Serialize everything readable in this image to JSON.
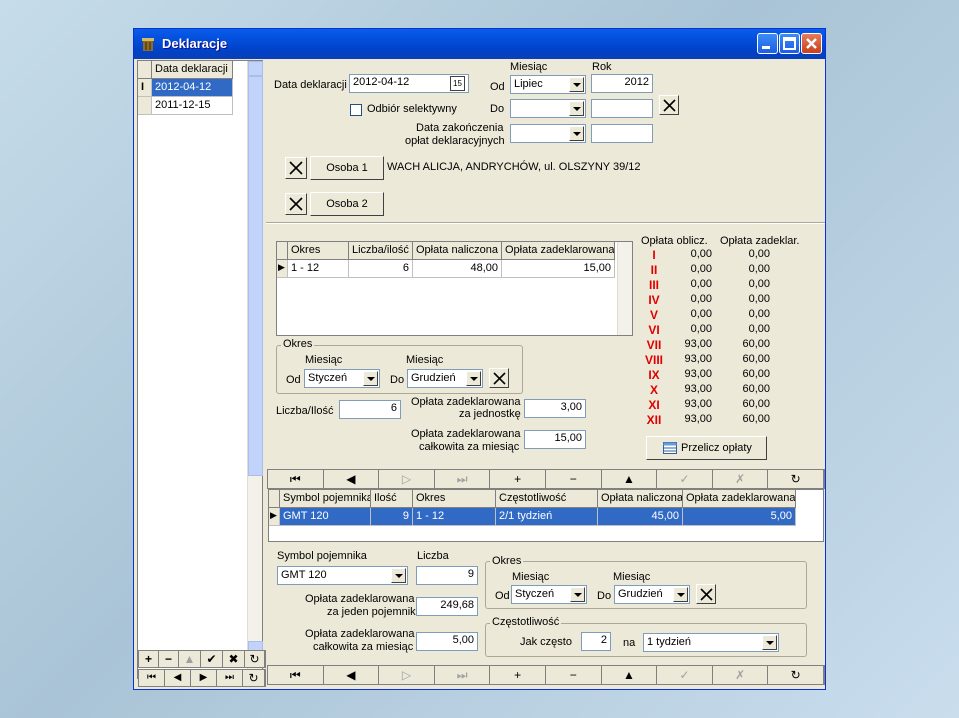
{
  "window": {
    "title": "Deklaracje"
  },
  "left_list": {
    "header": "Data deklaracji",
    "rows": [
      "2012-04-12",
      "2011-12-15"
    ]
  },
  "left_nav": {
    "row1": [
      "+",
      "−",
      "▲",
      "✔",
      "✖",
      "↻"
    ],
    "row2": [
      "⏮",
      "◀",
      "▶",
      "⏭",
      "↻"
    ]
  },
  "form": {
    "data_deklaracji_label": "Data deklaracji",
    "data_deklaracji_value": "2012-04-12",
    "calendar_icon_text": "15",
    "odbior_label": "Odbiór selektywny",
    "miesiac_header": "Miesiąc",
    "rok_header": "Rok",
    "od_label": "Od",
    "od_miesiac": "Lipiec",
    "od_rok": "2012",
    "do_label": "Do",
    "do_miesiac": "",
    "do_rok": "",
    "zakonczenie_line1": "Data zakończenia",
    "zakonczenie_line2": "opłat deklaracyjnych",
    "osoba1_label": "Osoba 1",
    "osoba1_text": "WACH ALICJA, ANDRYCHÓW, ul. OLSZYNY 39/12",
    "osoba2_label": "Osoba 2"
  },
  "period_grid": {
    "headers": [
      "Okres",
      "Liczba/ilość",
      "Opłata naliczona",
      "Opłata zadeklarowana"
    ],
    "rows": [
      [
        "1 - 12",
        "6",
        "48,00",
        "15,00"
      ]
    ]
  },
  "okres_group": {
    "title": "Okres",
    "miesiac1": "Miesiąc",
    "miesiac2": "Miesiąc",
    "od_label": "Od",
    "od_value": "Styczeń",
    "do_label": "Do",
    "do_value": "Grudzień"
  },
  "liczba": {
    "label": "Liczba/Ilość",
    "value": "6"
  },
  "oplata_jedn": {
    "line1": "Opłata zadeklarowana",
    "line2": "za jednostkę",
    "value": "3,00"
  },
  "oplata_calk": {
    "line1": "Opłata zadeklarowana",
    "line2": "całkowita za miesiąc",
    "value": "15,00"
  },
  "months_table": {
    "header_oblicz": "Opłata oblicz.",
    "header_zadekl": "Opłata zadeklar.",
    "rows": [
      [
        "I",
        "0,00",
        "0,00"
      ],
      [
        "II",
        "0,00",
        "0,00"
      ],
      [
        "III",
        "0,00",
        "0,00"
      ],
      [
        "IV",
        "0,00",
        "0,00"
      ],
      [
        "V",
        "0,00",
        "0,00"
      ],
      [
        "VI",
        "0,00",
        "0,00"
      ],
      [
        "VII",
        "93,00",
        "60,00"
      ],
      [
        "VIII",
        "93,00",
        "60,00"
      ],
      [
        "IX",
        "93,00",
        "60,00"
      ],
      [
        "X",
        "93,00",
        "60,00"
      ],
      [
        "XI",
        "93,00",
        "60,00"
      ],
      [
        "XII",
        "93,00",
        "60,00"
      ]
    ]
  },
  "przelicz_label": "Przelicz opłaty",
  "nav1": [
    "⏮",
    "◀",
    "▷",
    "⏭",
    "+",
    "−",
    "▲",
    "✓",
    "✗",
    "↻"
  ],
  "container_grid": {
    "headers": [
      "Symbol pojemnika",
      "Ilość",
      "Okres",
      "Częstotliwość",
      "Opłata naliczona",
      "Opłata zadeklarowana"
    ],
    "rows": [
      [
        "GMT 120",
        "9",
        "1 - 12",
        "2/1 tydzień",
        "45,00",
        "5,00"
      ]
    ]
  },
  "container_form": {
    "symbol_label": "Symbol pojemnika",
    "symbol_value": "GMT 120",
    "liczba_label": "Liczba",
    "liczba_value": "9",
    "jeden_line1": "Opłata zadeklarowana",
    "jeden_line2": "za jeden pojemnik",
    "jeden_value": "249,68",
    "calk_line1": "Opłata zadeklarowana",
    "calk_line2": "całkowita za miesiąc",
    "calk_value": "5,00"
  },
  "container_okres": {
    "title": "Okres",
    "miesiac1": "Miesiąc",
    "miesiac2": "Miesiąc",
    "od_label": "Od",
    "od_value": "Styczeń",
    "do_label": "Do",
    "do_value": "Grudzień"
  },
  "czestotliwosc": {
    "title": "Częstotliwość",
    "jak_label": "Jak często",
    "jak_value": "2",
    "na_label": "na",
    "na_value": "1 tydzień"
  },
  "nav2": [
    "⏮",
    "◀",
    "▷",
    "⏭",
    "+",
    "−",
    "▲",
    "✓",
    "✗",
    "↻"
  ]
}
